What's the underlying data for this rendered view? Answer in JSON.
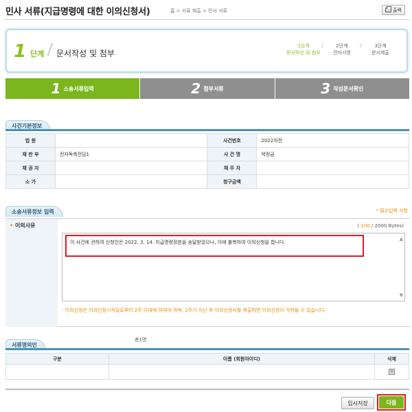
{
  "header": {
    "title": "민사 서류(지급명령에 대한 이의신청서)",
    "breadcrumb": "홈 > 서류 제출 > 민사 서류",
    "print_label": "출력"
  },
  "step_box": {
    "num": "1",
    "word": "단계",
    "title": "문서작성 및 첨부",
    "steps": [
      {
        "line1": "1단계",
        "line2": "문서작성 및 첨부"
      },
      {
        "line1": "2단계",
        "line2": "전자서명"
      },
      {
        "line1": "3단계",
        "line2": "문서제출"
      }
    ]
  },
  "tabs": [
    {
      "num": "1",
      "label": "소송서류입력"
    },
    {
      "num": "2",
      "label": "첨부서류"
    },
    {
      "num": "3",
      "label": "작성문서확인"
    }
  ],
  "case_info": {
    "section_title": "사건기본정보",
    "rows": [
      {
        "l1": "법 원",
        "v1": "",
        "l2": "사건번호",
        "v2": "2022차전"
      },
      {
        "l1": "재 판 부",
        "v1": "전자독촉전담1",
        "l2": "사 건 명",
        "v2": "약정금"
      },
      {
        "l1": "채 권 자",
        "v1": "",
        "l2": "채 무 자",
        "v2": ""
      },
      {
        "l1": "소 가",
        "v1": "",
        "l2": "청구금액",
        "v2": ""
      }
    ]
  },
  "input_section": {
    "section_title": "소송서류정보 입력",
    "required_note": "* 필수입력 사항",
    "reason_star": "•",
    "reason_label": "이의사유",
    "bytes_prefix": "( ",
    "bytes_current": "100",
    "bytes_suffix": " / 2000 Bytes)",
    "reason_text": "이 사건에 관하여 신청인은 2022. 3. 14. 지급명령정본을 송달받았으나, 이에 불복하여 이의신청을 합니다.",
    "warning": "- 이의신청은 이의신청시작일로부터 2주 이내에 하여야 하며, 2주가 지난 후 이의신청서를 제출하면 이의신청이 각하될 수 있습니다."
  },
  "signers": {
    "section_title": "서류명의인",
    "count": "총1명",
    "columns": [
      "구분",
      "이름 (회원아이디)",
      "삭제"
    ]
  },
  "buttons": {
    "temp_save": "임시저장",
    "next": "다음"
  }
}
